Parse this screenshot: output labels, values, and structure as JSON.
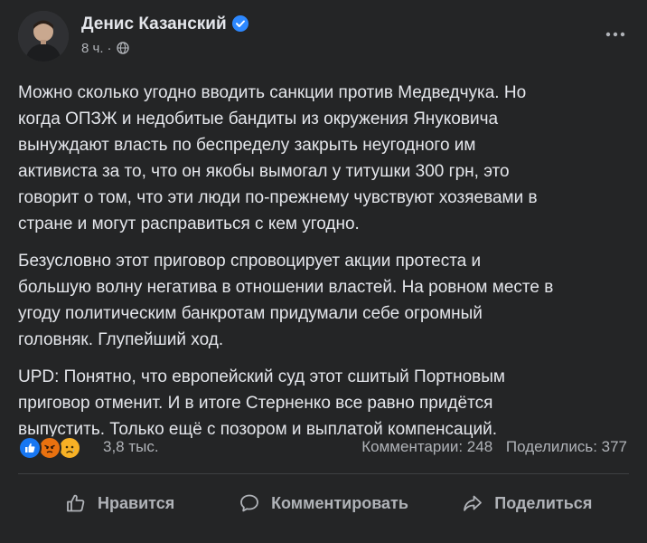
{
  "post": {
    "author": "Денис Казанский",
    "time": "8 ч.",
    "dot": "·",
    "paragraphs": [
      "Можно сколько угодно вводить санкции против Медведчука. Но\nкогда ОПЗЖ и недобитые бандиты из окружения Януковича\nвынуждают власть по беспределу закрыть неугодного им\nактивиста за то, что он якобы вымогал у титушки 300 грн, это\nговорит о том, что эти люди по-прежнему чувствуют хозяевами в\nстране и могут расправиться с кем угодно.",
      "Безусловно этот приговор спровоцирует акции протеста и\nбольшую волну негатива в отношении властей. На ровном месте в\nугоду политическим банкротам придумали себе огромный\nголовняк. Глупейший ход.",
      "UPD: Понятно, что европейский суд этот сшитый Портновым\nприговор отменит. И в итоге Стерненко все равно придётся\nвыпустить. Только ещё с позором и выплатой компенсаций."
    ]
  },
  "reactions": {
    "types": [
      "like",
      "angry",
      "sad"
    ],
    "count": "3,8 тыс.",
    "comments": "Комментарии: 248",
    "shares": "Поделились: 377"
  },
  "actions": {
    "like": "Нравится",
    "comment": "Комментировать",
    "share": "Поделиться"
  },
  "colors": {
    "background": "#242526",
    "text_primary": "#e4e6eb",
    "text_secondary": "#b0b3b8",
    "verified": "#2d88ff",
    "like": "#1877f2",
    "angry": "#e9710f",
    "sad": "#f7b125"
  }
}
